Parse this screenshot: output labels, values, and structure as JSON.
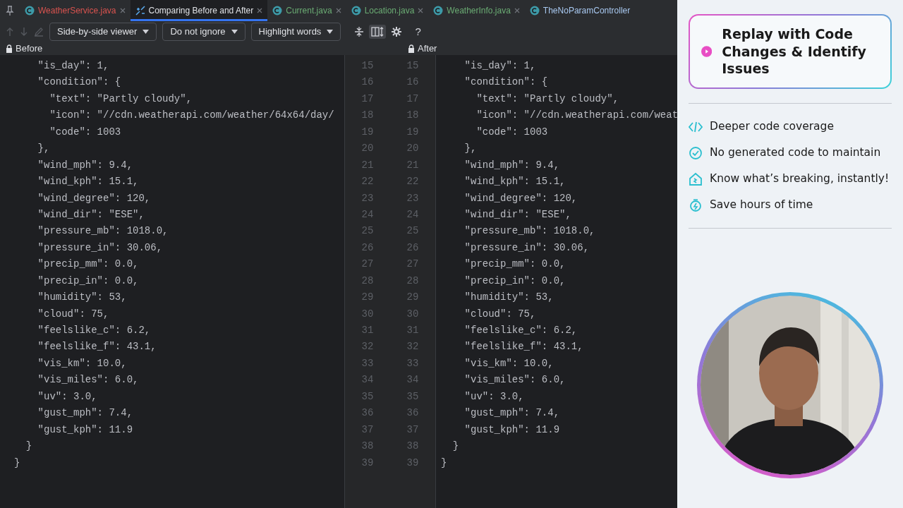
{
  "tabs": [
    {
      "kind": "file",
      "label": "WeatherService.java",
      "color": "#d9534f",
      "selected": false
    },
    {
      "kind": "diff",
      "label": "Comparing Before and After",
      "selected": true
    },
    {
      "kind": "file",
      "label": "Current.java",
      "color": "#6aab73",
      "selected": false
    },
    {
      "kind": "file",
      "label": "Location.java",
      "color": "#6aab73",
      "selected": false
    },
    {
      "kind": "file",
      "label": "WeatherInfo.java",
      "color": "#6aab73",
      "selected": false
    },
    {
      "kind": "cut",
      "label": "TheNoParamController",
      "color": "#a8c8f0",
      "selected": false
    }
  ],
  "toolbar": {
    "dropdowns": [
      "Side-by-side viewer",
      "Do not ignore",
      "Highlight words"
    ],
    "side_by_side_on": true,
    "help": "?"
  },
  "panes": {
    "left_title": "Before",
    "right_title": "After"
  },
  "rows": [
    {
      "left_num": "15",
      "right_num": "15",
      "before": "    \"is_day\": 1,",
      "after": "    \"is_day\": 1,"
    },
    {
      "left_num": "16",
      "right_num": "16",
      "before": "    \"condition\": {",
      "after": "    \"condition\": {"
    },
    {
      "left_num": "17",
      "right_num": "17",
      "before": "      \"text\": \"Partly cloudy\",",
      "after": "      \"text\": \"Partly cloudy\","
    },
    {
      "left_num": "18",
      "right_num": "18",
      "before": "      \"icon\": \"//cdn.weatherapi.com/weather/64x64/day/",
      "after": "      \"icon\": \"//cdn.weatherapi.com/weat"
    },
    {
      "left_num": "19",
      "right_num": "19",
      "before": "      \"code\": 1003",
      "after": "      \"code\": 1003"
    },
    {
      "left_num": "20",
      "right_num": "20",
      "before": "    },",
      "after": "    },"
    },
    {
      "left_num": "21",
      "right_num": "21",
      "before": "    \"wind_mph\": 9.4,",
      "after": "    \"wind_mph\": 9.4,"
    },
    {
      "left_num": "22",
      "right_num": "22",
      "before": "    \"wind_kph\": 15.1,",
      "after": "    \"wind_kph\": 15.1,"
    },
    {
      "left_num": "23",
      "right_num": "23",
      "before": "    \"wind_degree\": 120,",
      "after": "    \"wind_degree\": 120,"
    },
    {
      "left_num": "24",
      "right_num": "24",
      "before": "    \"wind_dir\": \"ESE\",",
      "after": "    \"wind_dir\": \"ESE\","
    },
    {
      "left_num": "25",
      "right_num": "25",
      "before": "    \"pressure_mb\": 1018.0,",
      "after": "    \"pressure_mb\": 1018.0,"
    },
    {
      "left_num": "26",
      "right_num": "26",
      "before": "    \"pressure_in\": 30.06,",
      "after": "    \"pressure_in\": 30.06,"
    },
    {
      "left_num": "27",
      "right_num": "27",
      "before": "    \"precip_mm\": 0.0,",
      "after": "    \"precip_mm\": 0.0,"
    },
    {
      "left_num": "28",
      "right_num": "28",
      "before": "    \"precip_in\": 0.0,",
      "after": "    \"precip_in\": 0.0,"
    },
    {
      "left_num": "29",
      "right_num": "29",
      "before": "    \"humidity\": 53,",
      "after": "    \"humidity\": 53,"
    },
    {
      "left_num": "30",
      "right_num": "30",
      "before": "    \"cloud\": 75,",
      "after": "    \"cloud\": 75,"
    },
    {
      "left_num": "31",
      "right_num": "31",
      "before": "    \"feelslike_c\": 6.2,",
      "after": "    \"feelslike_c\": 6.2,"
    },
    {
      "left_num": "32",
      "right_num": "32",
      "before": "    \"feelslike_f\": 43.1,",
      "after": "    \"feelslike_f\": 43.1,"
    },
    {
      "left_num": "33",
      "right_num": "33",
      "before": "    \"vis_km\": 10.0,",
      "after": "    \"vis_km\": 10.0,"
    },
    {
      "left_num": "34",
      "right_num": "34",
      "before": "    \"vis_miles\": 6.0,",
      "after": "    \"vis_miles\": 6.0,"
    },
    {
      "left_num": "35",
      "right_num": "35",
      "before": "    \"uv\": 3.0,",
      "after": "    \"uv\": 3.0,"
    },
    {
      "left_num": "36",
      "right_num": "36",
      "before": "    \"gust_mph\": 7.4,",
      "after": "    \"gust_mph\": 7.4,"
    },
    {
      "left_num": "37",
      "right_num": "37",
      "before": "    \"gust_kph\": 11.9",
      "after": "    \"gust_kph\": 11.9"
    },
    {
      "left_num": "38",
      "right_num": "38",
      "before": "  }",
      "after": "  }"
    },
    {
      "left_num": "39",
      "right_num": "39",
      "before": "}",
      "after": "}"
    }
  ],
  "promo": {
    "title": "Replay with Code Changes & Identify Issues",
    "features": [
      {
        "kind": "code",
        "text": "Deeper code coverage"
      },
      {
        "kind": "check",
        "text": "No generated code to maintain"
      },
      {
        "kind": "home",
        "text": "Know what’s breaking, instantly!"
      },
      {
        "kind": "timer",
        "text": "Save hours of time"
      }
    ]
  }
}
